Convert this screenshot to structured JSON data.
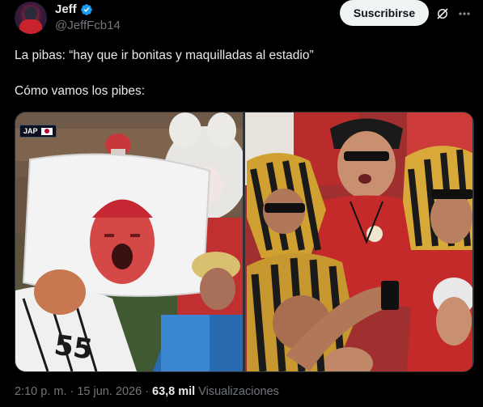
{
  "author": {
    "display_name": "Jeff",
    "handle": "@JeffFcb14",
    "verified": true
  },
  "actions": {
    "subscribe_label": "Suscribirse",
    "grok_icon": "grok-icon",
    "more_icon": "more-icon"
  },
  "tweet": {
    "line1": "La pibas: “hay que ir bonitas y maquilladas al estadio”",
    "line2": "Cómo vamos los pibes:"
  },
  "media": {
    "left_photo": {
      "badge_text": "JAP",
      "badge_flag": "japan-flag-icon"
    },
    "right_photo": {}
  },
  "meta": {
    "time": "2:10 p. m.",
    "separator": "·",
    "date": "15 jun. 2026",
    "views_count": "63,8 mil",
    "views_label": "Visualizaciones"
  },
  "colors": {
    "background": "#000000",
    "text": "#e7e9ea",
    "secondary_text": "#71767b",
    "verified_blue": "#1d9bf0",
    "button_bg": "#eff3f4"
  }
}
